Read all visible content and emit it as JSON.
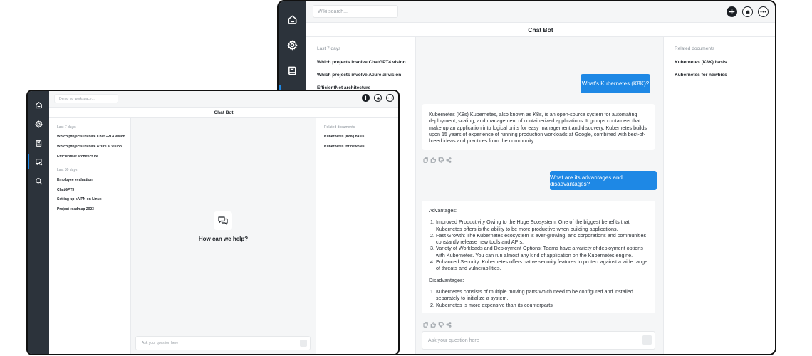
{
  "back": {
    "search_placeholder": "Wiki search...",
    "title": "Chat Bot",
    "history": {
      "last7_label": "Last 7 days",
      "last7_items": [
        "Which projects involve ChatGPT4 vision",
        "Which projects involve Azure ai vision",
        "EfficientNet architecture"
      ]
    },
    "related": {
      "label": "Related documents",
      "items": [
        "Kubernetes (K8K) basis",
        "Kubernetes for newbies"
      ]
    },
    "messages": {
      "q1": "What's Kubernetes (K8K)?",
      "a1": "Kubernetes (K8s) Kubernetes, also known as K8s, is an open-source system for automating deployment, scaling, and management of containerized applications. It groups containers that make up an application into logical units for easy management and discovery. Kubernetes builds upon 15 years of experience of running production workloads at Google, combined with best-of-breed ideas and practices from the community.",
      "q2": "What are its advantages and disadvantages?",
      "a2": {
        "adv_title": "Advantages:",
        "adv": [
          "Improved Productivity Owing to the Huge Ecosystem: One of the biggest benefits that Kubernetes offers is the ability to be more productive when building applications.",
          "Fast Growth: The Kubernetes ecosystem is ever-growing, and corporations and communities constantly release new tools and APIs.",
          "Variety of Workloads and Deployment Options: Teams have a variety of deployment options with Kubernetes. You can run almost any kind of application on the Kubernetes engine.",
          "Enhanced Security: Kubernetes offers native security features to protect against a wide range of threats and vulnerabilities."
        ],
        "dis_title": "Disadvantages:",
        "dis": [
          "Kubernetes consists of multiple moving parts which need to be configured and installed separately to initialize a system.",
          "Kubernetes is more expensive than its counterparts"
        ]
      }
    },
    "ask_placeholder": "Ask your question here"
  },
  "front": {
    "search_placeholder": "Demo no workspace...",
    "title": "Chat Bot",
    "history": {
      "last7_label": "Last 7 days",
      "last7_items": [
        "Which projects involve ChatGPT4 vision",
        "Which projects involve Azure ai vision",
        "EfficientNet architecture"
      ],
      "last30_label": "Last 30 days",
      "last30_items": [
        "Employee evaluation",
        "ChatGPT3",
        "Setting up a VPN on Linux",
        "Project roadmap 2023"
      ]
    },
    "related": {
      "label": "Related documents",
      "items": [
        "Kubernetes (K8K) basis",
        "Kubernetes for newbies"
      ]
    },
    "empty_state": "How can we help?",
    "ask_placeholder": "Ask your question here"
  },
  "colors": {
    "accent": "#1e88e5",
    "rail": "#2c333b",
    "background": "#f5f6f7"
  },
  "icons": {
    "rail": [
      "home-icon",
      "gear-icon",
      "bookmark-book-icon",
      "chat-search-icon",
      "search-icon"
    ],
    "toolbar": [
      "plus-icon",
      "bell-icon",
      "more-icon"
    ],
    "reactions": [
      "copy-icon",
      "thumbs-up-icon",
      "thumbs-down-icon",
      "share-icon"
    ]
  }
}
